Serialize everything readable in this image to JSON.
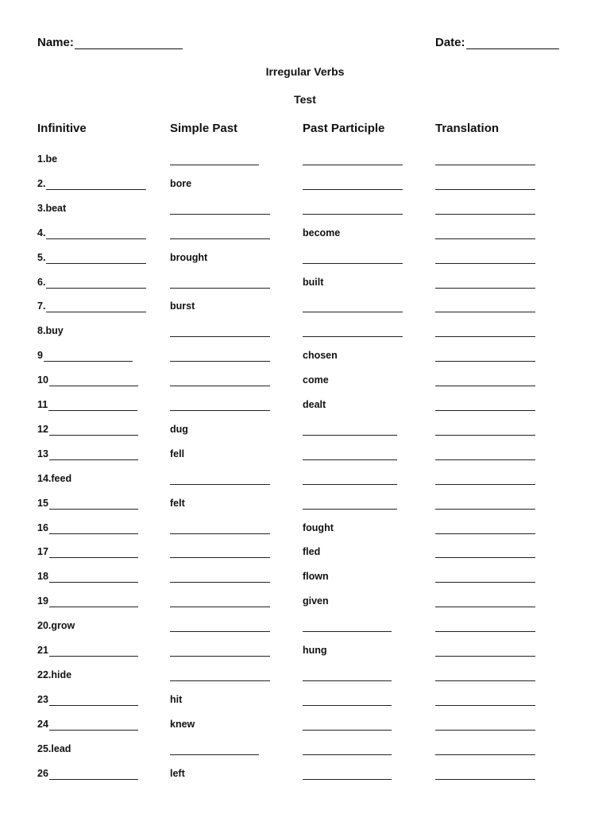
{
  "header": {
    "name_label": "Name:",
    "date_label": "Date:",
    "title": "Irregular Verbs",
    "subtitle": "Test"
  },
  "columns": [
    "Infinitive",
    "Simple Past",
    "Past Participle",
    "Translation"
  ],
  "rows": [
    {
      "num": "1.",
      "infinitive": "be",
      "simple_past": "",
      "past_participle": "",
      "translation": ""
    },
    {
      "num": "2.",
      "infinitive": "",
      "simple_past": "bore",
      "past_participle": "",
      "translation": ""
    },
    {
      "num": "3.",
      "infinitive": "beat",
      "simple_past": "",
      "past_participle": "",
      "translation": ""
    },
    {
      "num": "4.",
      "infinitive": "",
      "simple_past": "",
      "past_participle": "become",
      "translation": ""
    },
    {
      "num": "5.",
      "infinitive": "",
      "simple_past": "brought",
      "past_participle": "",
      "translation": ""
    },
    {
      "num": "6.",
      "infinitive": "",
      "simple_past": "",
      "past_participle": "built",
      "translation": ""
    },
    {
      "num": "7.",
      "infinitive": "",
      "simple_past": "burst",
      "past_participle": "",
      "translation": ""
    },
    {
      "num": "8.",
      "infinitive": "buy",
      "simple_past": "",
      "past_participle": "",
      "translation": ""
    },
    {
      "num": "9",
      "infinitive": "",
      "simple_past": "",
      "past_participle": "chosen",
      "translation": ""
    },
    {
      "num": "10",
      "infinitive": "",
      "simple_past": "",
      "past_participle": "come",
      "translation": ""
    },
    {
      "num": "11",
      "infinitive": "",
      "simple_past": "",
      "past_participle": "dealt",
      "translation": ""
    },
    {
      "num": "12",
      "infinitive": "",
      "simple_past": "dug",
      "past_participle": "",
      "translation": ""
    },
    {
      "num": "13",
      "infinitive": "",
      "simple_past": "fell",
      "past_participle": "",
      "translation": ""
    },
    {
      "num": "14.",
      "infinitive": "feed",
      "simple_past": "",
      "past_participle": "",
      "translation": ""
    },
    {
      "num": "15",
      "infinitive": "",
      "simple_past": "felt",
      "past_participle": "",
      "translation": ""
    },
    {
      "num": "16",
      "infinitive": "",
      "simple_past": "",
      "past_participle": "fought",
      "translation": ""
    },
    {
      "num": "17",
      "infinitive": "",
      "simple_past": "",
      "past_participle": "fled",
      "translation": ""
    },
    {
      "num": "18",
      "infinitive": "",
      "simple_past": "",
      "past_participle": "flown",
      "translation": ""
    },
    {
      "num": "19",
      "infinitive": "",
      "simple_past": "",
      "past_participle": "given",
      "translation": ""
    },
    {
      "num": "20.",
      "infinitive": "grow",
      "simple_past": "",
      "past_participle": "",
      "translation": ""
    },
    {
      "num": "21",
      "infinitive": "",
      "simple_past": "",
      "past_participle": "hung",
      "translation": ""
    },
    {
      "num": "22.",
      "infinitive": "hide",
      "simple_past": "",
      "past_participle": "",
      "translation": ""
    },
    {
      "num": "23",
      "infinitive": "",
      "simple_past": "hit",
      "past_participle": "",
      "translation": ""
    },
    {
      "num": "24",
      "infinitive": "",
      "simple_past": "knew",
      "past_participle": "",
      "translation": ""
    },
    {
      "num": "25.",
      "infinitive": "lead",
      "simple_past": "",
      "past_participle": "",
      "translation": ""
    },
    {
      "num": "26",
      "infinitive": "",
      "simple_past": "left",
      "past_participle": "",
      "translation": ""
    }
  ]
}
